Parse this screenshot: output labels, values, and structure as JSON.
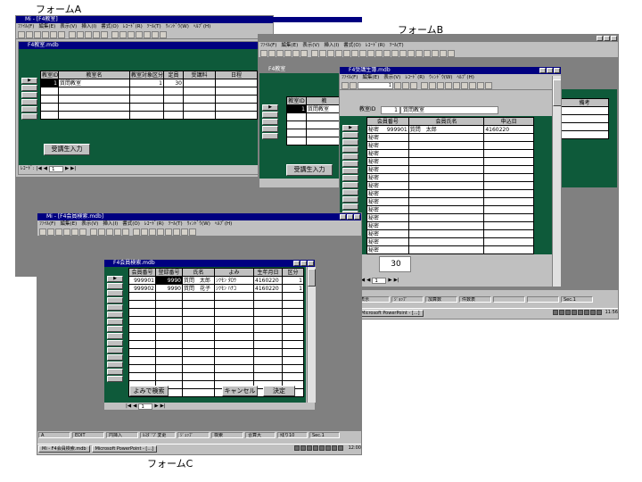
{
  "labels": {
    "form_a": "フォームA",
    "form_b": "フォームB",
    "form_c": "フォームC"
  },
  "colors": {
    "form_green": "#0e5a3a",
    "title_active": "#000080",
    "title_inactive": "#808080",
    "window_gray": "#c0c0c0"
  },
  "menu": [
    "ﾌｧｲﾙ(F)",
    "編集(E)",
    "表示(V)",
    "挿入(I)",
    "書式(O)",
    "ﾚｺｰﾄﾞ(R)",
    "ﾂｰﾙ(T)",
    "ｳｨﾝﾄﾞｳ(W)",
    "ﾍﾙﾌﾟ(H)"
  ],
  "form_a": {
    "app_title": "Mi - [F4教室]",
    "form_title": "F4教室.mdb",
    "columns": [
      "教室ID",
      "教室名",
      "教室対象区分",
      "定員",
      "受講料",
      "日程"
    ],
    "row": [
      "1",
      "質問教室",
      "1",
      "30",
      "",
      ""
    ],
    "button": "受講生入力",
    "record_label": "ﾚｺｰﾄﾞ:",
    "record_num": "1"
  },
  "form_b": {
    "form_title": "F4教室",
    "columns": [
      "教室ID",
      "教"
    ],
    "row": [
      "1",
      "質問教室"
    ],
    "button": "受講生入力",
    "right_header": "備考",
    "subform": {
      "title": "F4受講生簿.mdb",
      "page_box": "1",
      "id_label": "教室ID",
      "id_value": "1",
      "name_value": "質問教室",
      "columns": [
        "会員番号",
        "会員氏名",
        "申込日"
      ],
      "row": [
        "999901",
        "質問　太郎",
        "4160220"
      ],
      "placeholder_cell": "秘密",
      "empty_rows": 15,
      "capacity_label": "定員",
      "capacity_value": "30",
      "record_num": "1"
    },
    "status_items": [
      "表示",
      "ｼﾞｮｯﾌﾟ",
      "加算数",
      "件数表"
    ],
    "status_right": "Sec.1",
    "task": "Microsoft PowerPoint - [...]",
    "clock": "11:56"
  },
  "form_c": {
    "app_title": "Mi - [F4会員検索.mdb]",
    "form_title": "F4会員検索.mdb",
    "columns": [
      "会員番号",
      "登録番号",
      "氏名",
      "よみ",
      "生年月日",
      "区分"
    ],
    "rows": [
      [
        "999901",
        "9990",
        "質問　太郎",
        "ｼﾂﾓﾝ ﾀﾛｳ",
        "4160220",
        "1"
      ],
      [
        "999902",
        "9990",
        "質問　花子",
        "ｼﾂﾓﾝ ﾊﾅｺ",
        "4160220",
        "1"
      ]
    ],
    "empty_rows": 13,
    "buttons": {
      "search": "よみで検索",
      "cancel": "キャンセル",
      "ok": "決定"
    },
    "record_num": "1",
    "status_items": [
      "A",
      "EDIT",
      "円挿入",
      "ﾙｽﾀﾞ'ﾌﾟ変更",
      "ｼﾞｪｯﾌﾟ",
      "検索",
      "合算大",
      "残り10"
    ],
    "status_right": "Sec.1",
    "task_a": "Mi - F4会員検索.mdb",
    "task_b": "Microsoft PowerPoint - [...]",
    "clock": "12:00"
  }
}
